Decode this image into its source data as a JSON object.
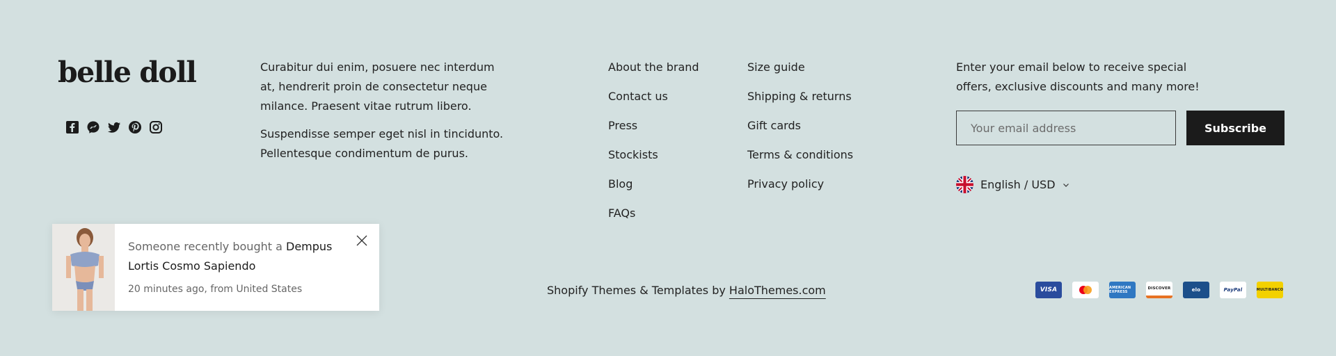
{
  "brand": {
    "logo_text": "belle doll"
  },
  "social": [
    {
      "icon": "facebook-icon"
    },
    {
      "icon": "messenger-icon"
    },
    {
      "icon": "twitter-icon"
    },
    {
      "icon": "pinterest-icon"
    },
    {
      "icon": "instagram-icon"
    }
  ],
  "about": {
    "p1": "Curabitur dui enim, posuere nec interdum at, hendrerit proin de consectetur neque milance. Praesent vitae rutrum libero.",
    "p2": "Suspendisse semper eget nisl in tincidunto. Pellentesque condimentum de purus."
  },
  "links_col1": [
    "About the brand",
    "Contact us",
    "Press",
    "Stockists",
    "Blog",
    "FAQs"
  ],
  "links_col2": [
    "Size guide",
    "Shipping & returns",
    "Gift cards",
    "Terms & conditions",
    "Privacy policy"
  ],
  "newsletter": {
    "text": "Enter your email below to receive special offers, exclusive discounts and many more!",
    "placeholder": "Your email address",
    "button_label": "Subscribe"
  },
  "locale": {
    "label": "English / USD",
    "flag_icon": "uk-flag-icon"
  },
  "copyright": {
    "prefix": "Shopify Themes & Templates by ",
    "link": "HaloThemes.com"
  },
  "payments": [
    "VISA",
    "mastercard",
    "AMERICAN EXPRESS",
    "DISCOVER",
    "elo",
    "PayPal",
    "MULTIBANCO"
  ],
  "popup": {
    "message_prefix": "Someone recently bought a ",
    "product": "Dempus Lortis Cosmo Sapiendo",
    "meta": "20 minutes ago, from United States"
  },
  "colors": {
    "background": "#d3e0e0",
    "button": "#1b1b1b",
    "popup_bg": "#ffffff"
  }
}
